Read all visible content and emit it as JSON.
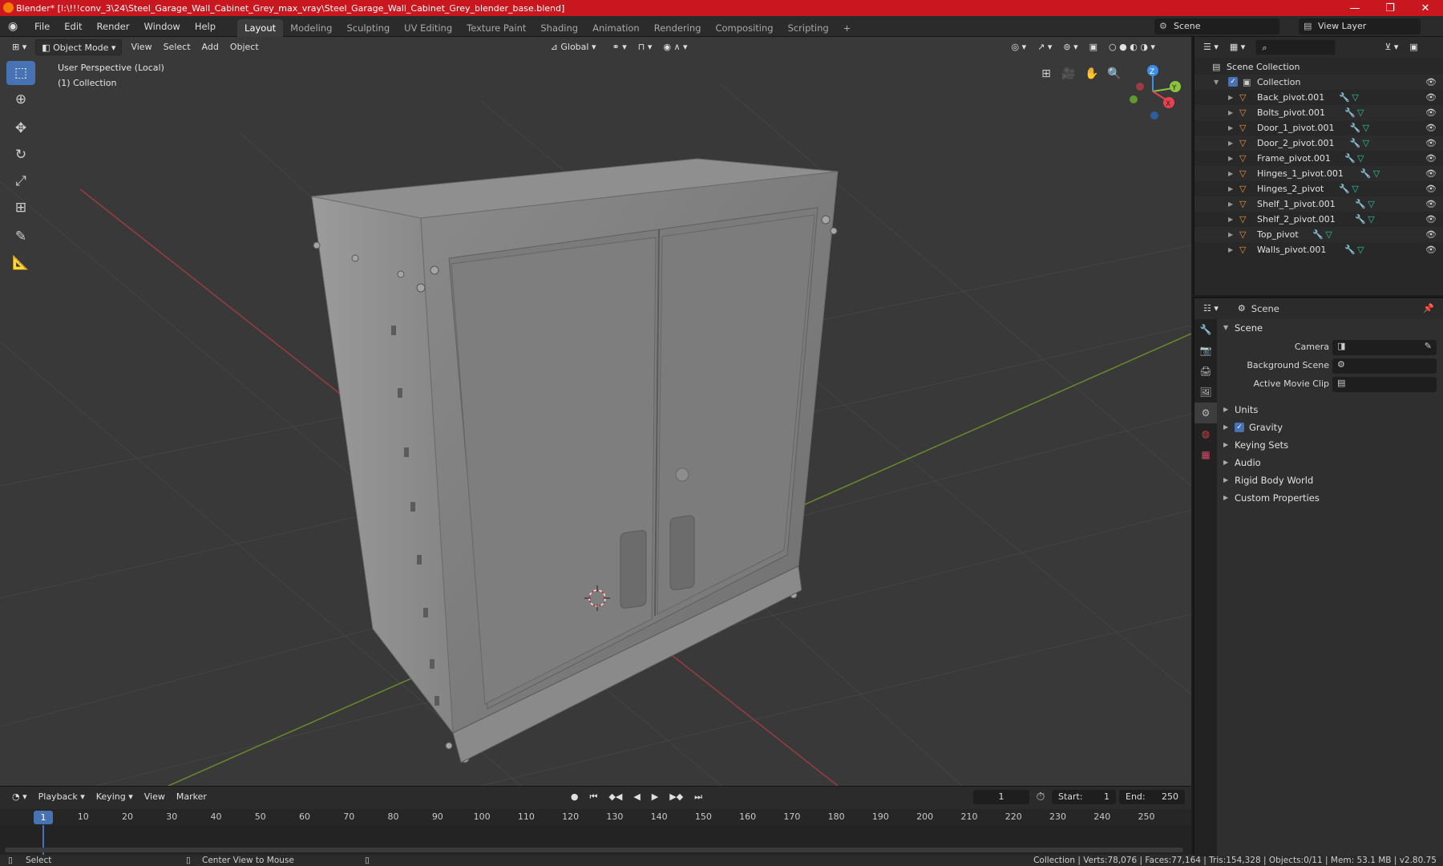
{
  "window": {
    "title": "Blender* [I:\\!!!conv_3\\24\\Steel_Garage_Wall_Cabinet_Grey_max_vray\\Steel_Garage_Wall_Cabinet_Grey_blender_base.blend]",
    "minimize": "—",
    "maximize": "❐",
    "close": "✕"
  },
  "menubar": {
    "menus": [
      "File",
      "Edit",
      "Render",
      "Window",
      "Help"
    ],
    "workspaces": [
      "Layout",
      "Modeling",
      "Sculpting",
      "UV Editing",
      "Texture Paint",
      "Shading",
      "Animation",
      "Rendering",
      "Compositing",
      "Scripting"
    ],
    "active_workspace": "Layout",
    "add_tab": "+",
    "scene": "Scene",
    "view_layer": "View Layer"
  },
  "viewport": {
    "mode": "Object Mode",
    "menus": [
      "View",
      "Select",
      "Add",
      "Object"
    ],
    "transform_orientation": "Global",
    "perspective_label": "User Perspective (Local)",
    "collection_label": "(1) Collection",
    "gizmo_axes": {
      "z": "Z",
      "y": "Y",
      "x": "X"
    }
  },
  "outliner": {
    "root": "Scene Collection",
    "collection": "Collection",
    "objects": [
      "Back_pivot.001",
      "Bolts_pivot.001",
      "Door_1_pivot.001",
      "Door_2_pivot.001",
      "Frame_pivot.001",
      "Hinges_1_pivot.001",
      "Hinges_2_pivot",
      "Shelf_1_pivot.001",
      "Shelf_2_pivot.001",
      "Top_pivot",
      "Walls_pivot.001"
    ]
  },
  "properties": {
    "context": "Scene",
    "panel": "Scene",
    "camera_label": "Camera",
    "background_scene_label": "Background Scene",
    "active_clip_label": "Active Movie Clip",
    "sections": [
      "Units",
      "Gravity",
      "Keying Sets",
      "Audio",
      "Rigid Body World",
      "Custom Properties"
    ],
    "gravity_enabled": true
  },
  "timeline": {
    "menus": [
      "Playback",
      "Keying",
      "View",
      "Marker"
    ],
    "current_frame": "1",
    "start_label": "Start:",
    "start": "1",
    "end_label": "End:",
    "end": "250",
    "ticks": [
      "1",
      "10",
      "20",
      "30",
      "40",
      "50",
      "60",
      "70",
      "80",
      "90",
      "100",
      "110",
      "120",
      "130",
      "140",
      "150",
      "160",
      "170",
      "180",
      "190",
      "200",
      "210",
      "220",
      "230",
      "240",
      "250"
    ]
  },
  "statusbar": {
    "left_action": "Select",
    "middle_action": "Center View to Mouse",
    "stats": "Collection | Verts:78,076 | Faces:77,164 | Tris:154,328 | Objects:0/11 | Mem: 53.1 MB | v2.80.75"
  },
  "colors": {
    "accent": "#4772b3",
    "title_bar": "#c8171f",
    "axis_x": "#e8414f",
    "axis_y": "#8ac63b",
    "axis_z": "#3d8ee6"
  }
}
